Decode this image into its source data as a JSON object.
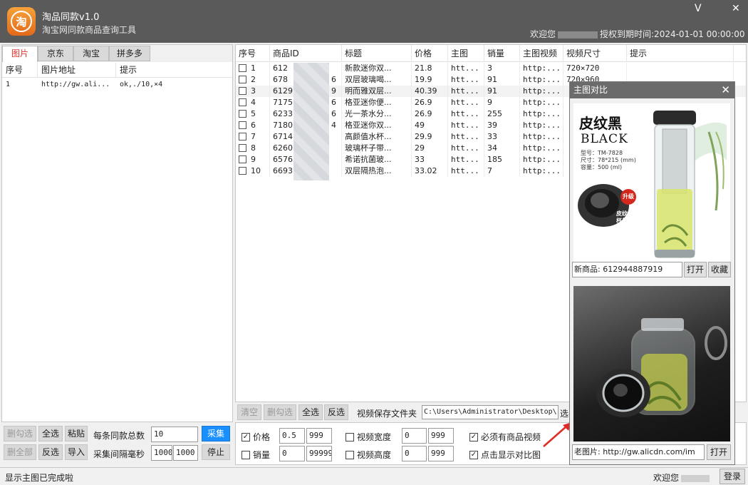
{
  "app": {
    "title": "淘品同款v1.0",
    "subtitle": "淘宝网同款商品查询工具",
    "logo_char": "淘",
    "minimize": "V",
    "close": "✕",
    "welcome": "欢迎您",
    "license": "授权到期时间:2024-01-01 00:00:00"
  },
  "left": {
    "tabs": [
      "图片",
      "京东",
      "淘宝",
      "拼多多"
    ],
    "headers": [
      "序号",
      "图片地址",
      "提示"
    ],
    "rows": [
      {
        "idx": "1",
        "url": "http://gw.ali...",
        "tip": "ok,./10,×4"
      }
    ]
  },
  "controls": {
    "uncheck": "删勾选",
    "select_all": "全选",
    "paste": "粘贴",
    "delete_all": "删全部",
    "invert": "反选",
    "import": "导入",
    "total_label": "每条同款总数",
    "total_value": "10",
    "interval_label": "采集间隔毫秒",
    "interval_min": "1000",
    "interval_max": "1000",
    "collect": "采集",
    "stop": "停止"
  },
  "grid": {
    "headers": [
      "序号",
      "商品ID",
      "标题",
      "价格",
      "主图",
      "销量",
      "主图视频",
      "视频尺寸",
      "提示"
    ],
    "rows": [
      {
        "idx": "1",
        "id": "612",
        "title": "新款迷你双...",
        "price": "21.8",
        "img": "htt...",
        "sales": "3",
        "video": "http:...",
        "size": "720×720"
      },
      {
        "idx": "2",
        "id": "678",
        "id_tail": "6",
        "title": "双层玻璃喝...",
        "price": "19.9",
        "img": "htt...",
        "sales": "91",
        "video": "http:...",
        "size": "720×960"
      },
      {
        "idx": "3",
        "id": "6129",
        "id_tail": "9",
        "title": "明而雅双层...",
        "price": "40.39",
        "img": "htt...",
        "sales": "91",
        "video": "http:...",
        "size": ""
      },
      {
        "idx": "4",
        "id": "7175",
        "id_tail": "6",
        "title": "格亚迷你便...",
        "price": "26.9",
        "img": "htt...",
        "sales": "9",
        "video": "http:...",
        "size": ""
      },
      {
        "idx": "5",
        "id": "6233",
        "id_tail": "6",
        "title": "光一茶水分...",
        "price": "26.9",
        "img": "htt...",
        "sales": "255",
        "video": "http:...",
        "size": ""
      },
      {
        "idx": "6",
        "id": "7180",
        "id_tail": "4",
        "title": "格亚迷你双...",
        "price": "49",
        "img": "htt...",
        "sales": "39",
        "video": "http:...",
        "size": ""
      },
      {
        "idx": "7",
        "id": "6714",
        "title": "高颜值水杯...",
        "price": "29.9",
        "img": "htt...",
        "sales": "33",
        "video": "http:...",
        "size": ""
      },
      {
        "idx": "8",
        "id": "6260",
        "title": "玻璃杯子带...",
        "price": "29",
        "img": "htt...",
        "sales": "34",
        "video": "http:...",
        "size": ""
      },
      {
        "idx": "9",
        "id": "6576",
        "title": "希诺抗菌玻...",
        "price": "33",
        "img": "htt...",
        "sales": "185",
        "video": "http:...",
        "size": ""
      },
      {
        "idx": "10",
        "id": "6693",
        "title": "双层隔热泡...",
        "price": "33.02",
        "img": "htt...",
        "sales": "7",
        "video": "http:...",
        "size": ""
      }
    ]
  },
  "toolbar": {
    "clear": "清空",
    "uncheck": "删勾选",
    "select_all": "全选",
    "invert": "反选",
    "folder_label": "视频保存文件夹",
    "folder_path": "C:\\Users\\Administrator\\Desktop\\",
    "folder_btn": "选"
  },
  "filters": {
    "price": {
      "label": "价格",
      "checked": true,
      "min": "0.5",
      "max": "999"
    },
    "sales": {
      "label": "销量",
      "checked": false,
      "min": "0",
      "max": "999999"
    },
    "vwidth": {
      "label": "视频宽度",
      "checked": false,
      "min": "0",
      "max": "999"
    },
    "vheight": {
      "label": "视频高度",
      "checked": false,
      "min": "0",
      "max": "999"
    },
    "must_video": {
      "label": "必须有商品视频",
      "checked": true
    },
    "show_compare": {
      "label": "点击显示对比图",
      "checked": true
    }
  },
  "status": {
    "message": "显示主图已完成啦",
    "welcome": "欢迎您",
    "login": "登录"
  },
  "compare": {
    "title": "主图对比",
    "close": "✕",
    "new_label": "新商品:",
    "new_id": "612944887919",
    "open": "打开",
    "favorite": "收藏",
    "old_label": "老图片:",
    "old_url": "http://gw.alicdn.com/im",
    "open2": "打开",
    "product": {
      "heading": "皮纹黑",
      "english": "BLACK",
      "model": "型号：TM-7828",
      "size": "尺寸：78*215 (mm)",
      "capacity": "容量：500 (ml)",
      "badge": "升级",
      "lid_line1": "皮纹",
      "lid_line2": "杯盖"
    }
  },
  "colors": {
    "titlebar": "#5a5a5a",
    "collect_button": "#1a8fff",
    "active_tab_text": "#e6312e",
    "arrow": "#e02a24"
  }
}
